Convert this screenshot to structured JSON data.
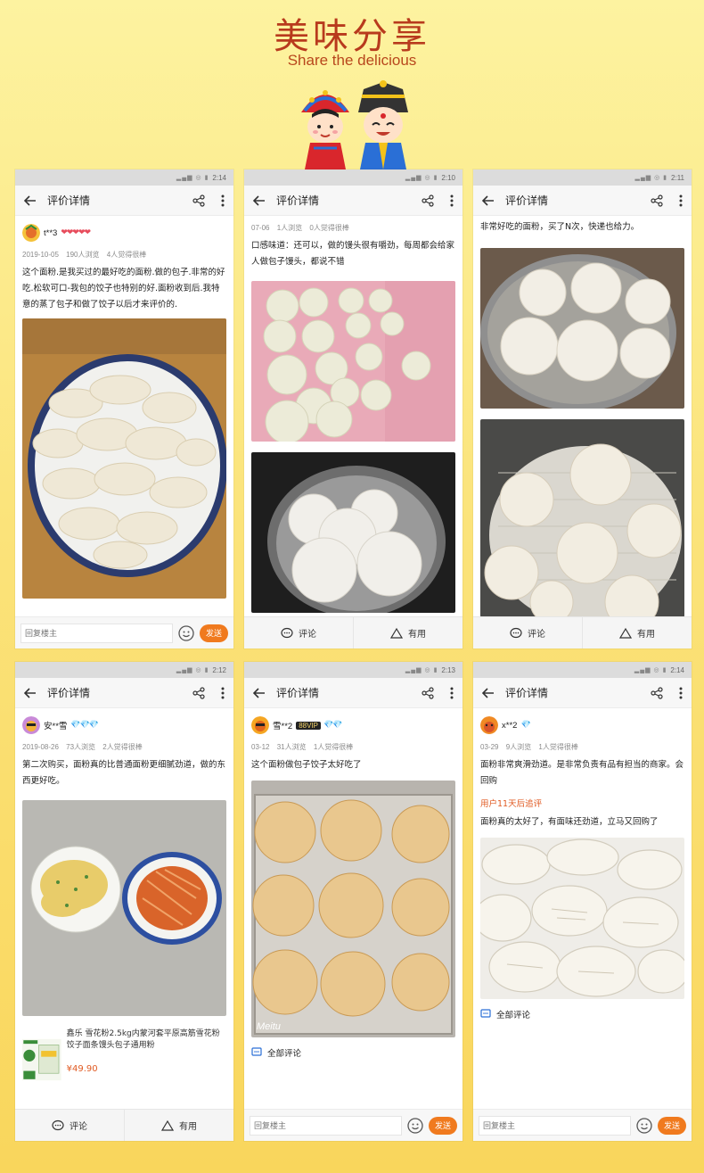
{
  "header": {
    "title_cn": "美味分享",
    "title_en": "Share the delicious"
  },
  "common": {
    "nav_title": "评价详情",
    "reply_placeholder": "回复楼主",
    "send_label": "发送",
    "comment_label": "评论",
    "useful_label": "有用",
    "all_comments_label": "全部评论"
  },
  "phones": [
    {
      "time": "2:14",
      "username": "t**3",
      "badges": "❤❤❤❤❤",
      "date": "2019-10-05",
      "views": "190人浏览",
      "likes": "4人觉得很棒",
      "text": "这个面粉.是我买过的最好吃的面粉.做的包子.非常的好吃.松软可口-我包的饺子也特别的好.面粉收到后.我特意的蒸了包子和做了饺子以后才来评价的."
    },
    {
      "time": "2:10",
      "date": "07-06",
      "views": "1人浏览",
      "likes": "0人觉得很棒",
      "text": "口感味道：还可以，做的馒头很有嚼劲，每周都会给家人做包子馒头，都说不错"
    },
    {
      "time": "2:11",
      "text": "非常好吃的面粉，买了N次，快递也给力。"
    },
    {
      "time": "2:12",
      "username": "安**雪",
      "badges": "💎💎💎",
      "date": "2019-08-26",
      "views": "73人浏览",
      "likes": "2人觉得很棒",
      "text": "第二次购买，面粉真的比普通面粉更细腻劲道，做的东西更好吃。",
      "product_title": "鑫乐 雪花粉2.5kg内蒙河套平原高筋雪花粉饺子面条馒头包子通用粉",
      "product_price": "¥49.90"
    },
    {
      "time": "2:13",
      "username": "雪**2",
      "vip": "88VIP",
      "badges": "💎💎",
      "date": "03-12",
      "views": "31人浏览",
      "likes": "1人觉得很棒",
      "text": "这个面粉做包子饺子太好吃了",
      "watermark": "Meitu"
    },
    {
      "time": "2:14",
      "username": "x**2",
      "badges": "💎",
      "date": "03-29",
      "views": "9人浏览",
      "likes": "1人觉得很棒",
      "text": "面粉非常爽滑劲道。是非常负责有品有担当的商家。会回购",
      "followup_tag": "用户11天后追评",
      "followup_text": "面粉真的太好了，有面味还劲道，立马又回购了"
    }
  ],
  "colors": {
    "accent": "#f07a1e",
    "title": "#b83a1d",
    "followup": "#e05a22"
  }
}
